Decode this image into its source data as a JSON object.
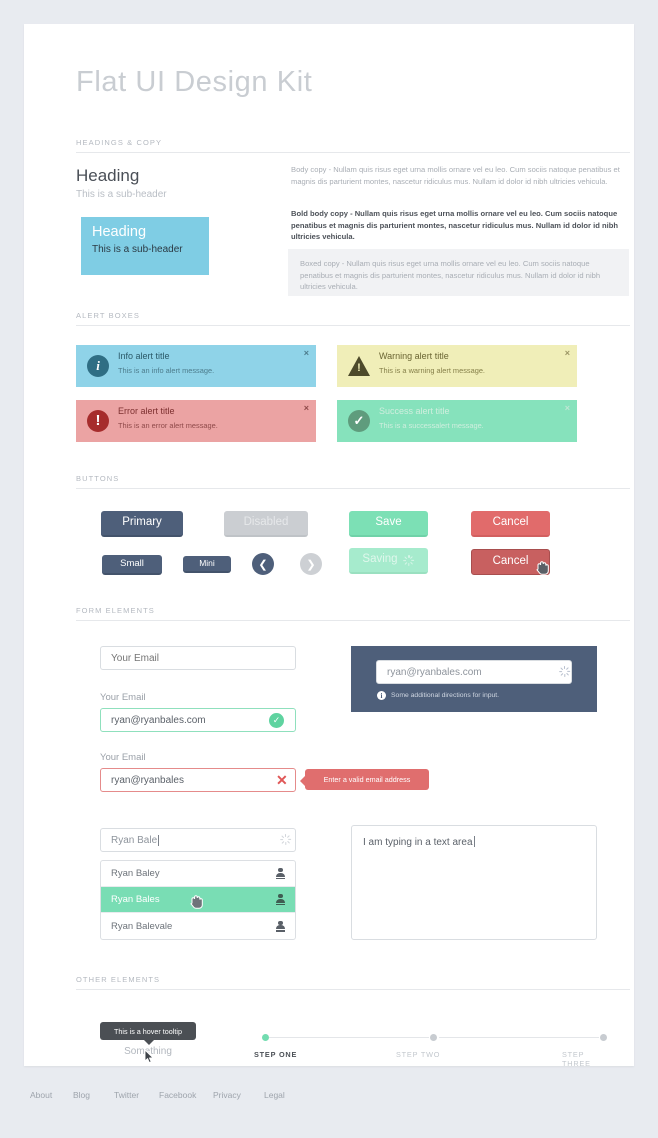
{
  "title": "Flat UI Design Kit",
  "sections": {
    "headings": "HEADINGS & COPY",
    "alerts": "ALERT BOXES",
    "buttons": "BUTTONS",
    "form": "FORM ELEMENTS",
    "other": "OTHER ELEMENTS"
  },
  "headings_copy": {
    "heading": "Heading",
    "subheader": "This is a sub-header",
    "box_heading": "Heading",
    "box_subheader": "This is a sub-header",
    "body_copy": "Body copy - Nullam quis risus eget urna mollis ornare vel eu leo. Cum sociis natoque penatibus et magnis dis parturient montes, nascetur ridiculus mus. Nullam id dolor id nibh ultricies vehicula.",
    "bold_copy": "Bold body copy - Nullam quis risus eget urna mollis ornare vel eu leo. Cum sociis natoque penatibus et magnis dis parturient montes, nascetur ridiculus mus. Nullam id dolor id nibh ultricies vehicula.",
    "boxed_copy": "Boxed copy - Nullam quis risus eget urna mollis ornare vel eu leo. Cum sociis natoque penatibus et magnis dis parturient montes, nascetur ridiculus mus. Nullam id dolor id nibh ultricies vehicula.",
    "box_color": "#7fcde4",
    "boxed_bg": "#f1f2f4"
  },
  "alerts": [
    {
      "kind": "info",
      "title": "Info alert title",
      "message": "This is an info alert message.",
      "close": "×",
      "bg": "#8fd3e8",
      "icon": "info-icon"
    },
    {
      "kind": "warning",
      "title": "Warning alert title",
      "message": "This is a warning alert message.",
      "close": "×",
      "bg": "#f0eeb8",
      "icon": "warning-triangle-icon"
    },
    {
      "kind": "error",
      "title": "Error alert title",
      "message": "This is an error alert message.",
      "close": "×",
      "bg": "#eba3a3",
      "icon": "error-icon"
    },
    {
      "kind": "success",
      "title": "Success alert title",
      "message": "This is a successalert message.",
      "close": "×",
      "bg": "#86e2bc",
      "icon": "check-circle-icon"
    }
  ],
  "buttons": {
    "primary": "Primary",
    "disabled": "Disabled",
    "save": "Save",
    "cancel": "Cancel",
    "small": "Small",
    "mini": "Mini",
    "saving": "Saving",
    "cancel_hover": "Cancel",
    "prev_icon": "❮",
    "next_icon": "❯",
    "colors": {
      "primary": "#4e5f7a",
      "disabled": "#cbced2",
      "save": "#7ce0b5",
      "saving": "#a6ebcd",
      "cancel": "#e16b6b",
      "cancel_hover": "#c86060"
    }
  },
  "form": {
    "empty_input_placeholder": "Your Email",
    "valid_label": "Your Email",
    "valid_value": "ryan@ryanbales.com",
    "valid_icon": "✓",
    "invalid_label": "Your Email",
    "invalid_value": "ryan@ryanbales",
    "invalid_icon": "✕",
    "error_tooltip": "Enter a valid email address",
    "dark_panel_value": "ryan@ryanbales.com",
    "dark_panel_hint": "Some additional directions for input.",
    "dark_panel_hint_icon": "i",
    "dark_panel_bg": "#4e5f7a",
    "autocomplete_value": "Ryan Bale",
    "autocomplete_options": [
      "Ryan Baley",
      "Ryan Bales",
      "Ryan Balevale"
    ],
    "autocomplete_selected_index": 1,
    "textarea_value": "I am typing in a text area"
  },
  "other": {
    "tooltip_text": "This is a hover tooltip",
    "tooltip_target": "Something",
    "steps": [
      {
        "label": "STEP ONE",
        "active": true
      },
      {
        "label": "STEP TWO",
        "active": false
      },
      {
        "label": "STEP THREE",
        "active": false
      }
    ],
    "active_step_color": "#72dcb0",
    "inactive_step_color": "#c8ccd1"
  },
  "footer": {
    "links": [
      "About",
      "Blog",
      "Twitter",
      "Facebook",
      "Privacy",
      "Legal"
    ]
  }
}
